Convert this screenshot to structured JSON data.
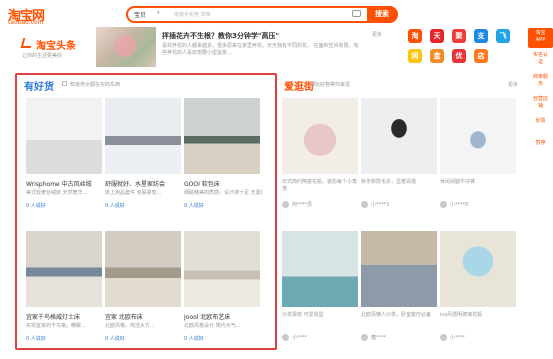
{
  "header": {
    "logo": "淘宝网",
    "logo_sub": "taobao.com",
    "search_category": "宝贝",
    "search_placeholder": "拼酱手机壳 草莓",
    "search_button": "搜索"
  },
  "headline": {
    "brand": "淘宝头条",
    "brand_sub": "让你的生活更美好",
    "title": "抨插花卉不生根？教你3分钟学\"高压\"",
    "desc": "喜欢养花的人越来越多，很多原来在家里养花，天天我有不同的花，\n在面积空间有限，有些养花的人喜欢想要小型盆景...",
    "more": "更多"
  },
  "apps": [
    {
      "glyph": "淘",
      "color": "#ff5000"
    },
    {
      "glyph": "天",
      "color": "#e4262b"
    },
    {
      "glyph": "聚",
      "color": "#f03b3b"
    },
    {
      "glyph": "支",
      "color": "#1e88e5"
    },
    {
      "glyph": "飞",
      "color": "#22a3e4"
    },
    {
      "glyph": "闲",
      "color": "#ffc410"
    },
    {
      "glyph": "盒",
      "color": "#f28c28"
    },
    {
      "glyph": "优",
      "color": "#e8353b"
    },
    {
      "glyph": "店",
      "color": "#ff7a1f"
    }
  ],
  "sidebar": [
    "淘宝APP",
    "实名认证",
    "商家服务",
    "自营店铺",
    "反馈",
    "暂停"
  ],
  "left_section": {
    "title": "有好货",
    "subtitle": "知道男女都在买的东西",
    "products": [
      {
        "name": "Wrisphome 中古风丝绒",
        "desc": "美式轻奢丝绒床 天然奢华...",
        "likes": "0 人说好"
      },
      {
        "name": "舒服就好、水星家纺会",
        "desc": "床上用品套件 亲肤柔软...",
        "likes": "0 人说好"
      },
      {
        "name": "GOOI 软包床",
        "desc": "细腻精美的质感，设计感十足 无需解释",
        "likes": "0 人说好"
      },
      {
        "name": "宜家千鸟格威灯士床",
        "desc": "实现宜家的千鸟格，精致...",
        "likes": "0 人说好"
      },
      {
        "name": "宜家 北欧布床",
        "desc": "北欧风格，简洁大方...",
        "likes": "0 人说好"
      },
      {
        "name": "Joool 北欧布艺床",
        "desc": "北欧风格设计 简约大气...",
        "likes": "0 人说好"
      }
    ]
  },
  "right_section": {
    "title": "爱逛街",
    "subtitle": "潮玩好物等你来逛",
    "more": "更多",
    "items": [
      {
        "desc": "日式简约陶瓷花瓶，装扮每个小角落",
        "user": "阿****员"
      },
      {
        "desc": "秋冬新款毛衣，显瘦百搭",
        "user": "小****3"
      },
      {
        "desc": "休闲阔腿牛仔裤",
        "user": "小****8"
      },
      {
        "desc": "沙发靠枕 可爱造型",
        "user": "小****"
      },
      {
        "desc": "北欧风懒人沙发，卧室客厅必备",
        "user": "糖****"
      },
      {
        "desc": "ins风透明玻璃花瓶",
        "user": "小****"
      }
    ]
  },
  "colors": {
    "accent": "#ff5000",
    "panel_border": "#e04040",
    "likes": "#2f7ad6"
  }
}
